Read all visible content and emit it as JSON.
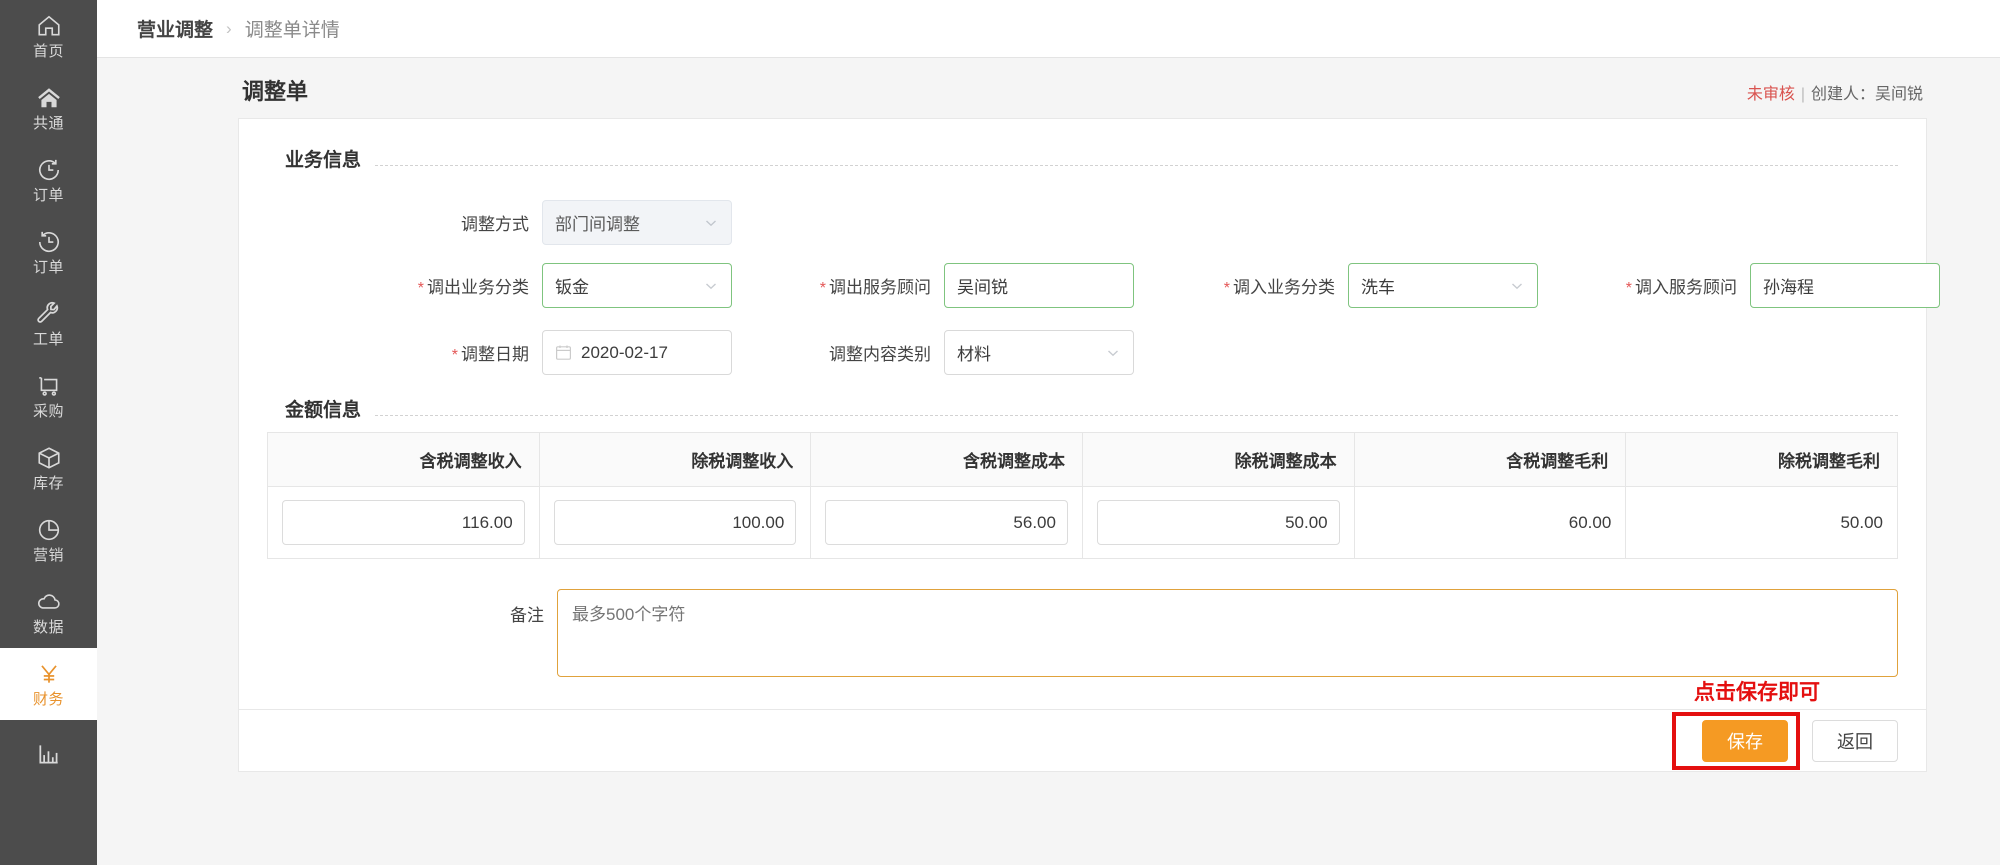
{
  "sidebar": {
    "items": [
      {
        "label": "首页",
        "icon": "home-outline-icon",
        "active": false
      },
      {
        "label": "共通",
        "icon": "home-filled-icon",
        "active": false
      },
      {
        "label": "订单",
        "icon": "clock-forward-icon",
        "active": false
      },
      {
        "label": "订单",
        "icon": "clock-back-icon",
        "active": false
      },
      {
        "label": "工单",
        "icon": "wrench-icon",
        "active": false
      },
      {
        "label": "采购",
        "icon": "cart-icon",
        "active": false
      },
      {
        "label": "库存",
        "icon": "box-icon",
        "active": false
      },
      {
        "label": "营销",
        "icon": "pie-chart-icon",
        "active": false
      },
      {
        "label": "数据",
        "icon": "cloud-icon",
        "active": false
      },
      {
        "label": "财务",
        "icon": "yuan-icon",
        "active": true
      },
      {
        "label": "",
        "icon": "bar-chart-icon",
        "active": false
      }
    ]
  },
  "breadcrumb": {
    "root": "营业调整",
    "separator": "›",
    "leaf": "调整单详情"
  },
  "page": {
    "title": "调整单",
    "status": "未审核",
    "status_divider": "|",
    "creator_text": "创建人：吴间锐",
    "status_color": "#d9534f"
  },
  "business_section": {
    "heading": "业务信息",
    "adjust_method": {
      "label": "调整方式",
      "value": "部门间调整",
      "required": false,
      "disabled": true
    },
    "out_category": {
      "label": "调出业务分类",
      "value": "钣金",
      "required": true
    },
    "out_advisor": {
      "label": "调出服务顾问",
      "value": "吴间锐",
      "required": true
    },
    "in_category": {
      "label": "调入业务分类",
      "value": "洗车",
      "required": true
    },
    "in_advisor": {
      "label": "调入服务顾问",
      "value": "孙海程",
      "required": true
    },
    "adjust_date": {
      "label": "调整日期",
      "value": "2020-02-17",
      "required": true
    },
    "content_type": {
      "label": "调整内容类别",
      "value": "材料",
      "required": false
    }
  },
  "amount_section": {
    "heading": "金额信息",
    "columns": [
      "含税调整收入",
      "除税调整收入",
      "含税调整成本",
      "除税调整成本",
      "含税调整毛利",
      "除税调整毛利"
    ],
    "values": [
      "116.00",
      "100.00",
      "56.00",
      "50.00",
      "60.00",
      "50.00"
    ],
    "editable": [
      true,
      true,
      true,
      true,
      false,
      false
    ]
  },
  "remark": {
    "label": "备注",
    "value": "",
    "placeholder": "最多500个字符"
  },
  "annotation": {
    "text": "点击保存即可",
    "color": "#e40f0f"
  },
  "footer": {
    "save_label": "保存",
    "back_label": "返回",
    "save_color": "#f59a23"
  }
}
